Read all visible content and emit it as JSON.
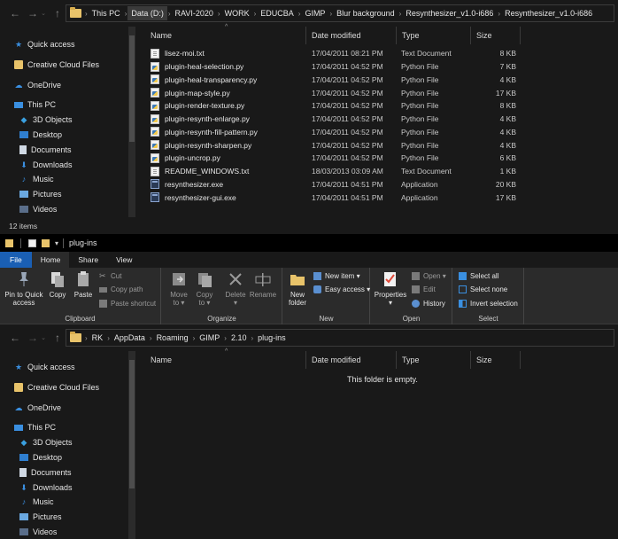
{
  "top_window": {
    "breadcrumb": [
      "This PC",
      "Data (D:)",
      "RAVI-2020",
      "WORK",
      "EDUCBA",
      "GIMP",
      "Blur background",
      "Resynthesizer_v1.0-i686",
      "Resynthesizer_v1.0-i686"
    ],
    "columns": {
      "name": "Name",
      "date": "Date modified",
      "type": "Type",
      "size": "Size"
    },
    "nav": [
      "Quick access",
      "Creative Cloud Files",
      "OneDrive",
      "This PC",
      "3D Objects",
      "Desktop",
      "Documents",
      "Downloads",
      "Music",
      "Pictures",
      "Videos"
    ],
    "files": [
      {
        "name": "lisez-moi.txt",
        "date": "17/04/2011 08:21 PM",
        "type": "Text Document",
        "size": "8 KB",
        "icon": "text-file-icon"
      },
      {
        "name": "plugin-heal-selection.py",
        "date": "17/04/2011 04:52 PM",
        "type": "Python File",
        "size": "7 KB",
        "icon": "python-file-icon"
      },
      {
        "name": "plugin-heal-transparency.py",
        "date": "17/04/2011 04:52 PM",
        "type": "Python File",
        "size": "4 KB",
        "icon": "python-file-icon"
      },
      {
        "name": "plugin-map-style.py",
        "date": "17/04/2011 04:52 PM",
        "type": "Python File",
        "size": "17 KB",
        "icon": "python-file-icon"
      },
      {
        "name": "plugin-render-texture.py",
        "date": "17/04/2011 04:52 PM",
        "type": "Python File",
        "size": "8 KB",
        "icon": "python-file-icon"
      },
      {
        "name": "plugin-resynth-enlarge.py",
        "date": "17/04/2011 04:52 PM",
        "type": "Python File",
        "size": "4 KB",
        "icon": "python-file-icon"
      },
      {
        "name": "plugin-resynth-fill-pattern.py",
        "date": "17/04/2011 04:52 PM",
        "type": "Python File",
        "size": "4 KB",
        "icon": "python-file-icon"
      },
      {
        "name": "plugin-resynth-sharpen.py",
        "date": "17/04/2011 04:52 PM",
        "type": "Python File",
        "size": "4 KB",
        "icon": "python-file-icon"
      },
      {
        "name": "plugin-uncrop.py",
        "date": "17/04/2011 04:52 PM",
        "type": "Python File",
        "size": "6 KB",
        "icon": "python-file-icon"
      },
      {
        "name": "README_WINDOWS.txt",
        "date": "18/03/2013 03:09 AM",
        "type": "Text Document",
        "size": "1 KB",
        "icon": "text-file-icon"
      },
      {
        "name": "resynthesizer.exe",
        "date": "17/04/2011 04:51 PM",
        "type": "Application",
        "size": "20 KB",
        "icon": "application-icon"
      },
      {
        "name": "resynthesizer-gui.exe",
        "date": "17/04/2011 04:51 PM",
        "type": "Application",
        "size": "17 KB",
        "icon": "application-icon"
      }
    ],
    "status": "12 items"
  },
  "bottom_window": {
    "title": "plug-ins",
    "tabs": [
      "File",
      "Home",
      "Share",
      "View"
    ],
    "ribbon": {
      "clipboard": {
        "pin": "Pin to Quick\naccess",
        "copy": "Copy",
        "paste": "Paste",
        "cut": "Cut",
        "copy_path": "Copy path",
        "paste_shortcut": "Paste shortcut",
        "label": "Clipboard"
      },
      "organize": {
        "move": "Move\nto ▾",
        "copy": "Copy\nto ▾",
        "delete": "Delete\n▾",
        "rename": "Rename",
        "label": "Organize"
      },
      "new": {
        "new_folder": "New\nfolder",
        "new_item": "New item ▾",
        "easy_access": "Easy access ▾",
        "label": "New"
      },
      "open": {
        "properties": "Properties\n▾",
        "open": "Open ▾",
        "edit": "Edit",
        "history": "History",
        "label": "Open"
      },
      "select": {
        "select_all": "Select all",
        "select_none": "Select none",
        "invert": "Invert selection",
        "label": "Select"
      }
    },
    "breadcrumb": [
      "RK",
      "AppData",
      "Roaming",
      "GIMP",
      "2.10",
      "plug-ins"
    ],
    "columns": {
      "name": "Name",
      "date": "Date modified",
      "type": "Type",
      "size": "Size"
    },
    "nav": [
      "Quick access",
      "Creative Cloud Files",
      "OneDrive",
      "This PC",
      "3D Objects",
      "Desktop",
      "Documents",
      "Downloads",
      "Music",
      "Pictures",
      "Videos"
    ],
    "empty_message": "This folder is empty."
  },
  "colors": {
    "background": "#191919",
    "ribbon": "#2b2b2b",
    "file_tab": "#1a5fb4",
    "folder": "#e8c36a"
  }
}
